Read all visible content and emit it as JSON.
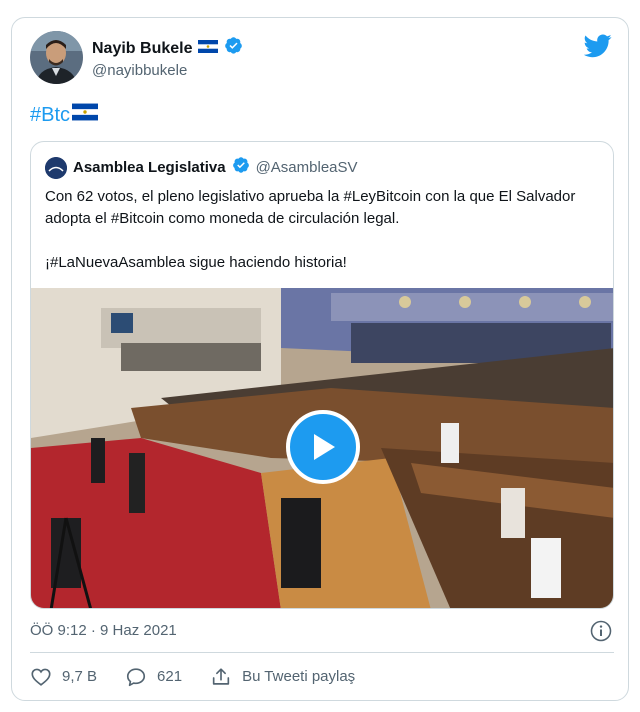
{
  "author": {
    "name": "Nayib Bukele",
    "handle": "@nayibbukele"
  },
  "tweet": {
    "text": "#Btc"
  },
  "quote": {
    "author_name": "Asamblea Legislativa",
    "author_handle": "@AsambleaSV",
    "line1": "Con 62 votos, el pleno legislativo aprueba la #LeyBitcoin con la que El Salvador adopta el #Bitcoin como moneda de circulación legal.",
    "line2": "¡#LaNuevaAsamblea sigue haciendo historia!"
  },
  "meta": {
    "timestamp": "ÖÖ 9:12 · 9 Haz 2021"
  },
  "actions": {
    "likes": "9,7 B",
    "replies": "621",
    "share": "Bu Tweeti paylaş"
  },
  "colors": {
    "accent": "#1d9bf0",
    "secondary_text": "#536471",
    "border": "#cfd9de"
  },
  "icons": [
    "avatar",
    "flag-el-salvador-icon",
    "verified-badge-icon",
    "twitter-bird-icon",
    "play-icon",
    "info-icon",
    "heart-icon",
    "reply-icon",
    "share-icon"
  ]
}
